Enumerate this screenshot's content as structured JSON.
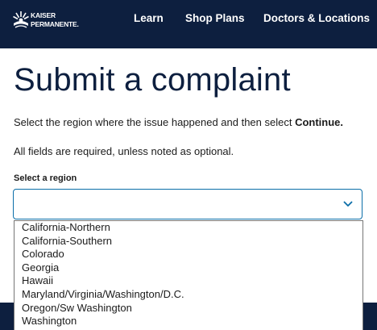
{
  "header": {
    "logo_line1": "KAISER",
    "logo_line2": "PERMANENTE.",
    "nav": {
      "learn": "Learn",
      "shop_plans": "Shop Plans",
      "doctors_locations": "Doctors & Locations"
    }
  },
  "main": {
    "title": "Submit a complaint",
    "instruction_text": "Select the region where the issue happened and then select ",
    "instruction_bold": "Continue.",
    "required_note": "All fields are required, unless noted as optional.",
    "region_label": "Select a region",
    "region_value": "",
    "region_options": [
      "California-Northern",
      "California-Southern",
      "Colorado",
      "Georgia",
      "Hawaii",
      "Maryland/Virginia/Washington/D.C.",
      "Oregon/Sw Washington",
      "Washington"
    ]
  },
  "colors": {
    "header_bg": "#0d1f3f",
    "title_color": "#0d1f3f",
    "select_border": "#0b6ea8"
  },
  "icons": [
    "kaiser-logo-icon",
    "chevron-down-icon"
  ]
}
